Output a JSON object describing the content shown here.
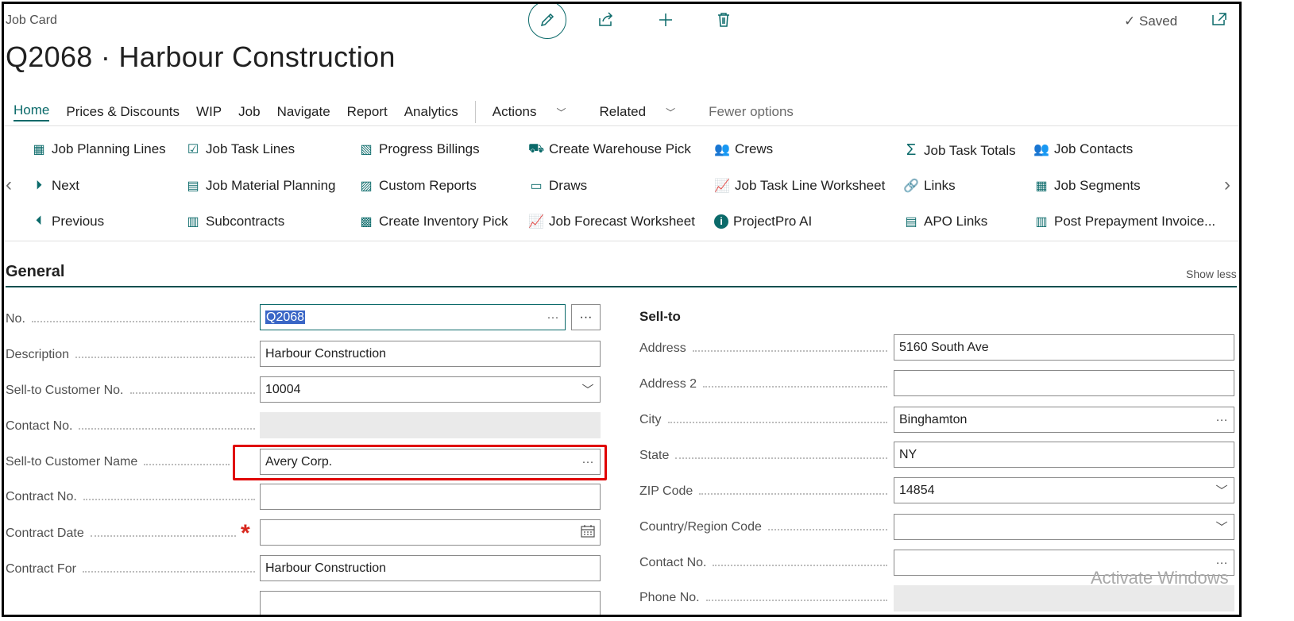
{
  "header": {
    "breadcrumb": "Job Card",
    "title": "Q2068 · Harbour Construction",
    "saved": "Saved"
  },
  "menu": {
    "items": [
      "Home",
      "Prices & Discounts",
      "WIP",
      "Job",
      "Navigate",
      "Report",
      "Analytics"
    ],
    "actions": "Actions",
    "related": "Related",
    "fewer": "Fewer options"
  },
  "actions": {
    "col1": [
      "Job Planning Lines",
      "Next",
      "Previous"
    ],
    "col2": [
      "Job Task Lines",
      "Job Material Planning",
      "Subcontracts"
    ],
    "col3": [
      "Progress Billings",
      "Custom Reports",
      "Create Inventory Pick"
    ],
    "col4": [
      "Create Warehouse Pick",
      "Draws",
      "Job Forecast Worksheet"
    ],
    "col5": [
      "Crews",
      "Job Task Line Worksheet",
      "ProjectPro AI"
    ],
    "col6": [
      "Job Task Totals",
      "Links",
      "APO Links"
    ],
    "col7": [
      "Job Contacts",
      "Job Segments",
      "Post Prepayment Invoice..."
    ]
  },
  "general": {
    "title": "General",
    "show_less": "Show less",
    "fields": {
      "no": {
        "label": "No.",
        "value": "Q2068"
      },
      "description": {
        "label": "Description",
        "value": "Harbour Construction"
      },
      "customer_no": {
        "label": "Sell-to Customer No.",
        "value": "10004"
      },
      "contact_no": {
        "label": "Contact No.",
        "value": ""
      },
      "customer_name": {
        "label": "Sell-to Customer Name",
        "value": "Avery Corp."
      },
      "contract_no": {
        "label": "Contract No.",
        "value": ""
      },
      "contract_date": {
        "label": "Contract Date",
        "value": ""
      },
      "contract_for": {
        "label": "Contract For",
        "value": "Harbour Construction"
      }
    },
    "sellto": {
      "heading": "Sell-to",
      "address": {
        "label": "Address",
        "value": "5160 South Ave"
      },
      "address2": {
        "label": "Address 2",
        "value": ""
      },
      "city": {
        "label": "City",
        "value": "Binghamton"
      },
      "state": {
        "label": "State",
        "value": "NY"
      },
      "zip": {
        "label": "ZIP Code",
        "value": "14854"
      },
      "country": {
        "label": "Country/Region Code",
        "value": ""
      },
      "contact_no": {
        "label": "Contact No.",
        "value": ""
      },
      "phone": {
        "label": "Phone No.",
        "value": ""
      }
    }
  },
  "watermark": "Activate Windows",
  "colors": {
    "accent": "#0b6a6a",
    "highlight": "#e00000",
    "selection": "#3a66c6"
  }
}
